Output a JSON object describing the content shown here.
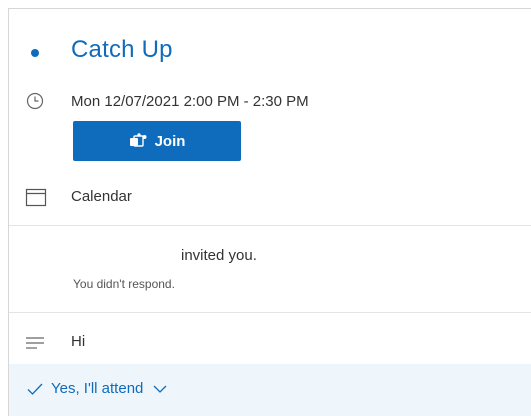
{
  "event": {
    "title": "Catch Up",
    "datetime": "Mon 12/07/2021 2:00 PM - 2:30 PM",
    "join_label": "Join",
    "calendar_label": "Calendar",
    "invited_text": "invited you.",
    "response_status": "You didn't respond.",
    "note": "Hi",
    "rsvp_label": "Yes, I'll attend"
  },
  "colors": {
    "accent": "#0f6cbd",
    "rsvp_background": "#eef5fb"
  },
  "icons": [
    "status-dot-icon",
    "clock-icon",
    "teams-icon",
    "calendar-icon",
    "notes-icon",
    "check-icon",
    "chevron-down-icon"
  ]
}
